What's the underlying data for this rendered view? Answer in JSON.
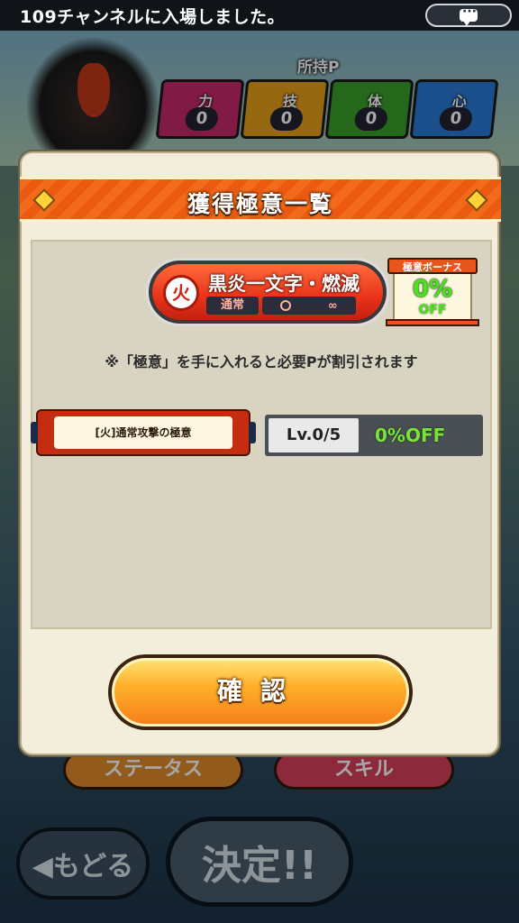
{
  "notification": {
    "message": "109チャンネルに入場しました。",
    "chat_icon": "chat-bubble-icon"
  },
  "header": {
    "owned_label": "所持P",
    "stats": [
      {
        "label": "力",
        "value": "0",
        "color": "#c62a6a"
      },
      {
        "label": "技",
        "value": "0",
        "color": "#e6a21a"
      },
      {
        "label": "体",
        "value": "0",
        "color": "#3aa02a"
      },
      {
        "label": "心",
        "value": "0",
        "color": "#2a7ad6"
      }
    ]
  },
  "background_buttons": {
    "status": "ステータス",
    "skill": "スキル",
    "back": "◀もどる",
    "decide": "決定!!"
  },
  "modal": {
    "title": "獲得極意一覧",
    "skill": {
      "element_icon": "火",
      "name": "黒炎一文字・燃滅",
      "type": "通常",
      "duration": "∞"
    },
    "bonus": {
      "caption": "極意ボーナス",
      "percent": "0%",
      "off": "OFF"
    },
    "note": "※「極意」を手に入れると必要Pが割引されます",
    "items": [
      {
        "name": "[火]通常攻撃の極意",
        "level": "Lv.0/5",
        "discount": "0%OFF"
      }
    ],
    "confirm_label": "確認"
  },
  "colors": {
    "accent_orange": "#f26a1a",
    "off_green": "#4ae21a",
    "fire_red": "#e8331a"
  }
}
